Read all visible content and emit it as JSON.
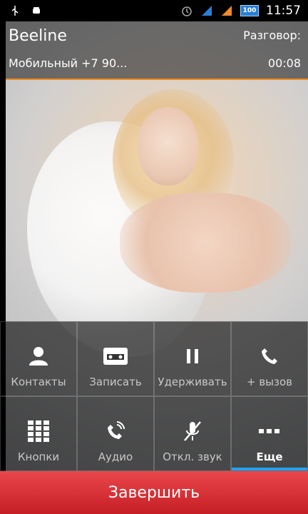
{
  "status_bar": {
    "time": "11:57",
    "battery": "100",
    "icons": [
      "usb-icon",
      "android-debug-icon",
      "alarm-icon",
      "signal-sim1-icon",
      "signal-sim2-icon",
      "battery-icon"
    ]
  },
  "call": {
    "carrier": "Beeline",
    "status": "Разговор:",
    "number": "Мобильный +7 90...",
    "duration": "00:08"
  },
  "controls": [
    {
      "label": "Контакты",
      "icon": "contacts-icon"
    },
    {
      "label": "Записать",
      "icon": "record-icon"
    },
    {
      "label": "Удерживать",
      "icon": "pause-icon"
    },
    {
      "label": "+ вызов",
      "icon": "add-call-icon"
    },
    {
      "label": "Кнопки",
      "icon": "dialpad-icon"
    },
    {
      "label": "Аудио",
      "icon": "audio-icon"
    },
    {
      "label": "Откл. звук",
      "icon": "mute-icon"
    },
    {
      "label": "Еще",
      "icon": "more-icon"
    }
  ],
  "end_call": {
    "label": "Завершить"
  },
  "colors": {
    "accent_orange": "#f18a1a",
    "accent_blue": "#21a3ff",
    "end_call_red": "#d8343a"
  }
}
